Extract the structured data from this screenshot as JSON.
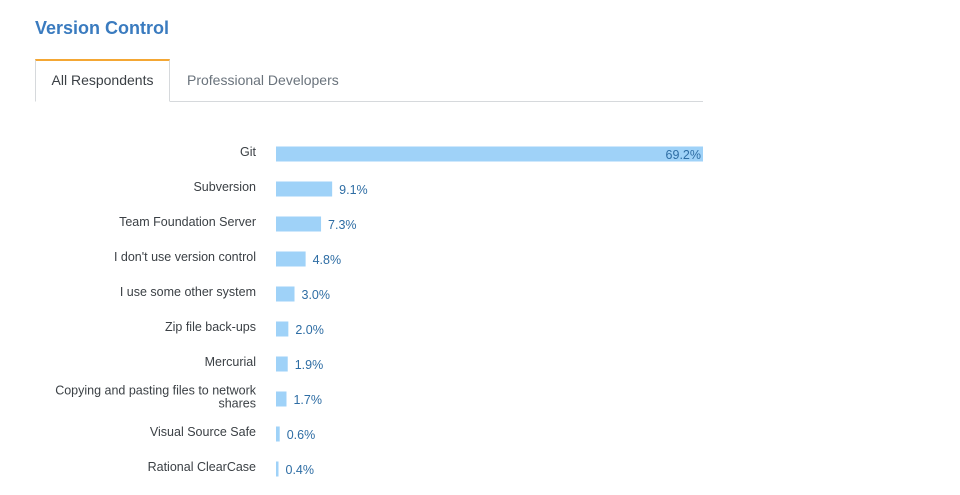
{
  "title": "Version Control",
  "tabs": [
    {
      "label": "All Respondents",
      "active": true
    },
    {
      "label": "Professional Developers",
      "active": false
    }
  ],
  "colors": {
    "bar": "#9fd2f8",
    "title": "#3a7bbf",
    "tab_accent": "#f4a734",
    "value_label": "#2e6da4"
  },
  "chart_data": {
    "type": "bar",
    "orientation": "horizontal",
    "categories": [
      "Git",
      "Subversion",
      "Team Foundation Server",
      "I don't use version control",
      "I use some other system",
      "Zip file back-ups",
      "Mercurial",
      "Copying and pasting files to network shares",
      "Visual Source Safe",
      "Rational ClearCase"
    ],
    "values": [
      69.2,
      9.1,
      7.3,
      4.8,
      3.0,
      2.0,
      1.9,
      1.7,
      0.6,
      0.4
    ],
    "value_labels": [
      "69.2%",
      "9.1%",
      "7.3%",
      "4.8%",
      "3.0%",
      "2.0%",
      "1.9%",
      "1.7%",
      "0.6%",
      "0.4%"
    ],
    "unit": "%",
    "xlim": [
      0,
      69.2
    ],
    "grid": false,
    "legend": "none"
  }
}
